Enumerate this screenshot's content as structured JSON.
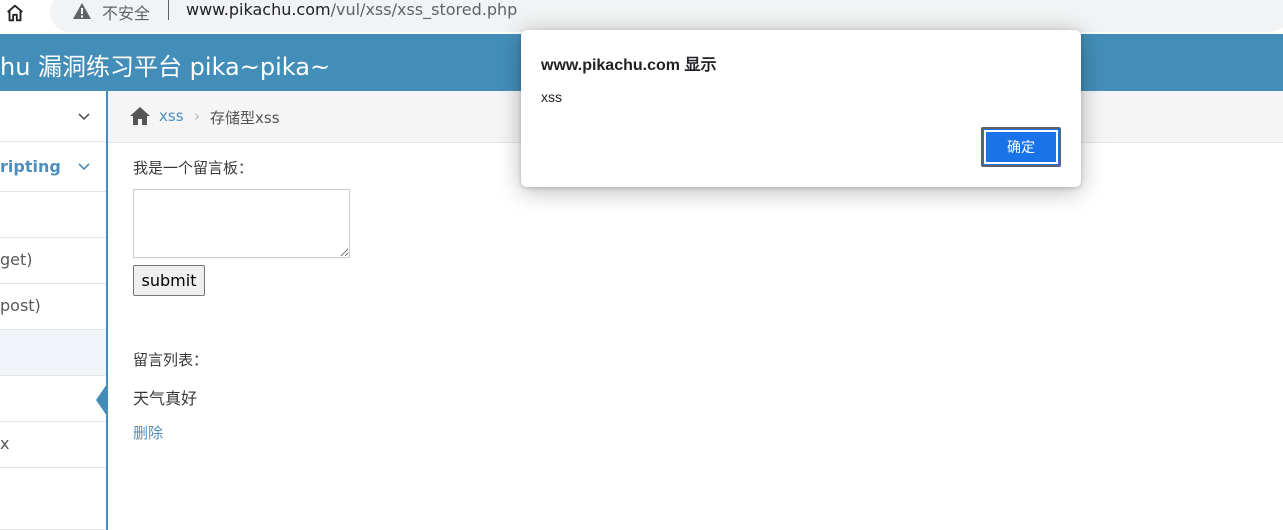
{
  "browser": {
    "insecure_label": "不安全",
    "url_host": "www.pikachu.com",
    "url_path": "/vul/xss/xss_stored.php"
  },
  "header": {
    "title": "hu 漏洞练习平台 pika~pika~"
  },
  "sidebar": {
    "items": [
      {
        "label": ""
      },
      {
        "label": "ripting"
      },
      {
        "label": ""
      },
      {
        "label": "get)"
      },
      {
        "label": "post)"
      },
      {
        "label": ""
      },
      {
        "label": ""
      },
      {
        "label": "x"
      }
    ]
  },
  "breadcrumb": {
    "link": "xss",
    "separator": "›",
    "current": "存储型xss"
  },
  "main": {
    "board_label": "我是一个留言板：",
    "textarea_value": "",
    "submit_label": "submit",
    "list_label": "留言列表：",
    "messages": [
      {
        "text": "天气真好",
        "delete_label": "删除"
      }
    ]
  },
  "alert": {
    "title": "www.pikachu.com 显示",
    "message": "xss",
    "ok_label": "确定"
  },
  "colors": {
    "header_bg": "#438eb9",
    "link": "#4c8fbd",
    "alert_ok_bg": "#1a73e8"
  },
  "icons": {
    "home": "home-icon",
    "warning": "warning-icon",
    "breadcrumb_home": "home-icon",
    "chevron": "chevron-down-icon"
  }
}
